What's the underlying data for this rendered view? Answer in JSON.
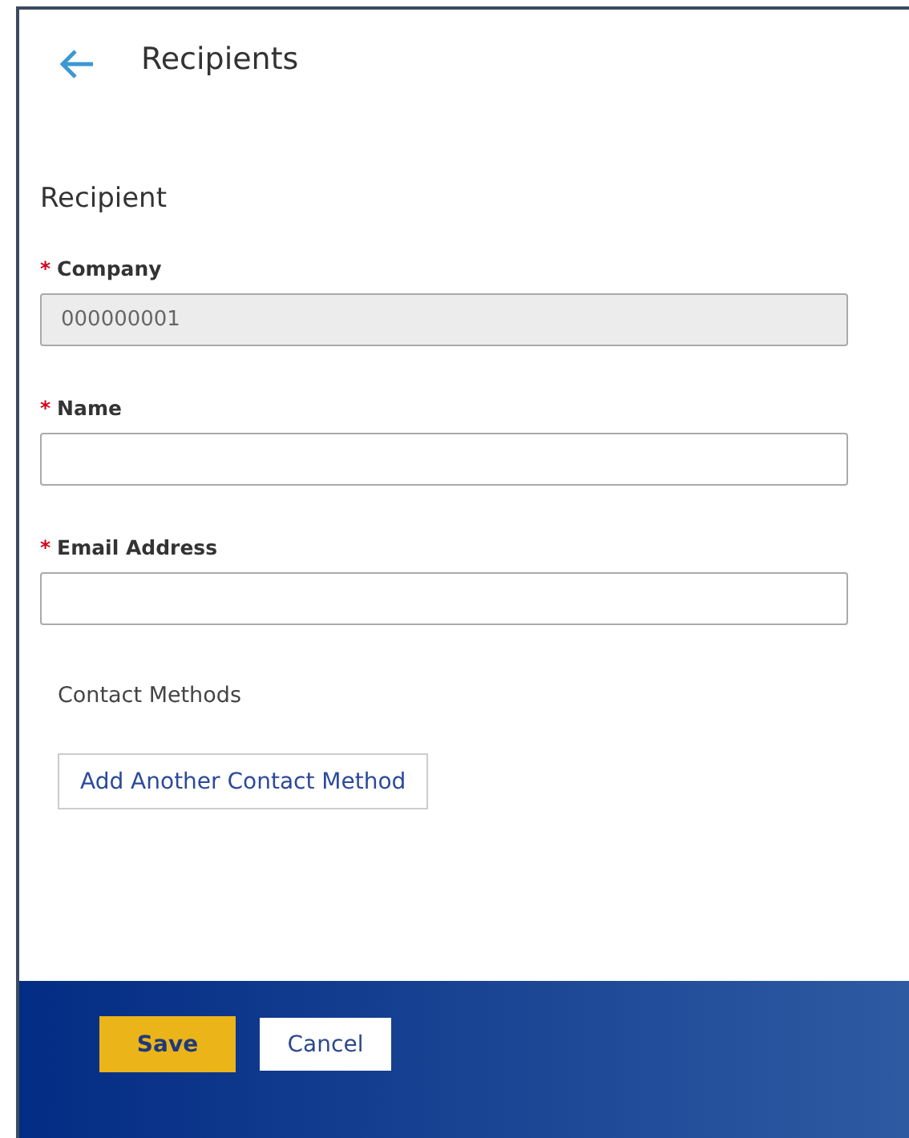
{
  "header": {
    "title": "Recipients"
  },
  "section": {
    "title": "Recipient"
  },
  "fields": [
    {
      "label": "Company",
      "required": true,
      "disabled": true,
      "value": "000000001"
    },
    {
      "label": "Name",
      "required": true,
      "disabled": false
    },
    {
      "label": "Email Address",
      "required": true,
      "disabled": false
    }
  ],
  "required_mark": "*",
  "contact_methods": {
    "label": "Contact Methods",
    "button": "Add Another Contact Method"
  },
  "footer": {
    "buttons": [
      {
        "label": "Save",
        "kind": "primary"
      },
      {
        "label": "Cancel",
        "kind": "secondary"
      }
    ]
  }
}
